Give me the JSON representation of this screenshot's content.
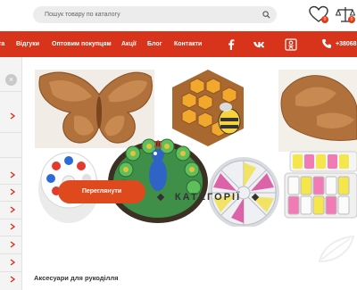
{
  "header": {
    "search_placeholder": "Пошук товару по каталогу",
    "wishlist_count": "0",
    "compare_count": "0"
  },
  "nav": {
    "items": [
      "та",
      "Відгуки",
      "Оптовим покупцям",
      "Акції",
      "Блог",
      "Контакти"
    ],
    "social": [
      "facebook-icon",
      "vk-icon",
      "odnoklassniki-icon"
    ],
    "phone": "+38068"
  },
  "banner": {
    "button_label": "Переглянути"
  },
  "section": {
    "title": "КАТЕГОРІЇ",
    "first_category": "Аксесуари для рукоділля"
  },
  "colors": {
    "accent": "#d8331b",
    "button": "#de4a1d",
    "wood": "#b0713c"
  }
}
